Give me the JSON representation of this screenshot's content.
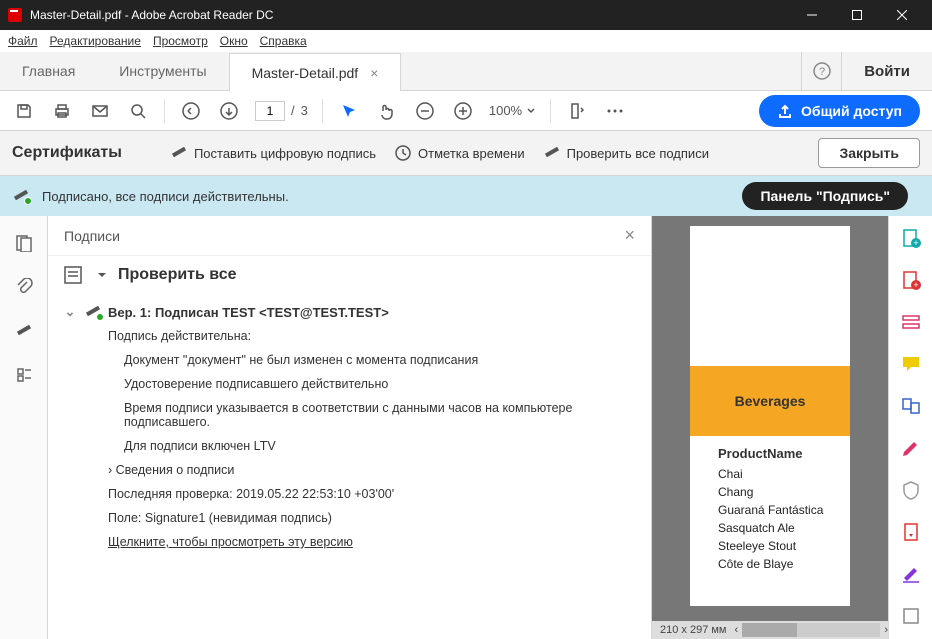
{
  "window": {
    "title": "Master-Detail.pdf - Adobe Acrobat Reader DC"
  },
  "menu": {
    "file": "Файл",
    "edit": "Редактирование",
    "view": "Просмотр",
    "window": "Окно",
    "help": "Справка"
  },
  "tabs": {
    "home": "Главная",
    "tools": "Инструменты",
    "doc": "Master-Detail.pdf",
    "login": "Войти"
  },
  "toolbar": {
    "page_current": "1",
    "page_sep": "/",
    "page_total": "3",
    "zoom": "100%",
    "share": "Общий доступ"
  },
  "certbar": {
    "title": "Сертификаты",
    "sign": "Поставить цифровую подпись",
    "timestamp": "Отметка времени",
    "verify": "Проверить все подписи",
    "close": "Закрыть"
  },
  "signbar": {
    "msg": "Подписано, все подписи действительны.",
    "panel": "Панель \"Подпись\""
  },
  "sigpanel": {
    "title": "Подписи",
    "verify_all": "Проверить все",
    "rev1": "Вер. 1: Подписан TEST <TEST@TEST.TEST>",
    "valid": "Подпись действительна:",
    "line1": "Документ \"документ\" не был изменен с момента подписания",
    "line2": "Удостоверение подписавшего действительно",
    "line3": "Время подписи указывается в соответствии с данными часов на компьютере подписавшего.",
    "line4": "Для подписи включен LTV",
    "details": "Сведения о подписи",
    "lastcheck": "Последняя проверка: 2019.05.22 22:53:10 +03'00'",
    "field": "Поле: Signature1 (невидимая подпись)",
    "viewver": "Щелкните, чтобы просмотреть эту версию"
  },
  "doc": {
    "category": "Beverages",
    "col": "ProductName",
    "items": [
      "Chai",
      "Chang",
      "Guaraná Fantástica",
      "Sasquatch Ale",
      "Steeleye Stout",
      "Côte de Blaye"
    ]
  },
  "status": {
    "dim": "210 x 297 мм"
  }
}
